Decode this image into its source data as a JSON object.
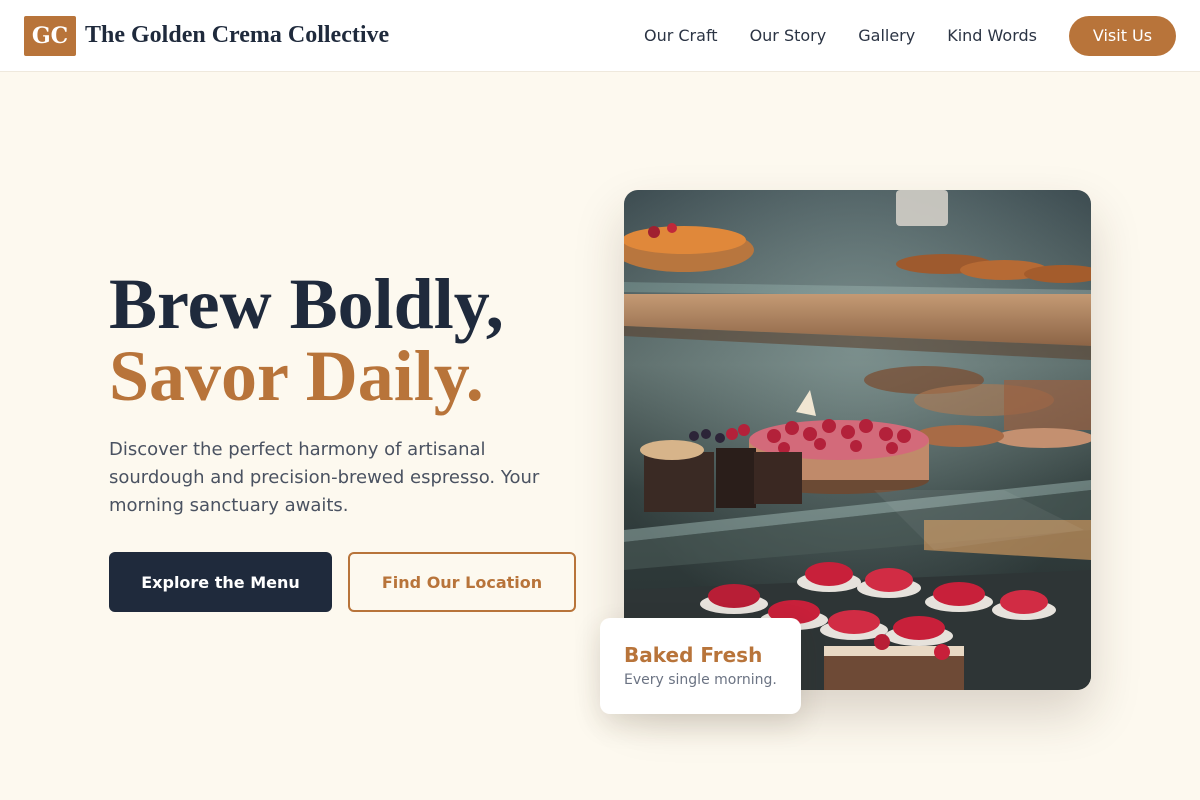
{
  "brand": {
    "logo_text": "GC",
    "name": "The Golden Crema Collective"
  },
  "nav": {
    "links": [
      "Our Craft",
      "Our Story",
      "Gallery",
      "Kind Words"
    ],
    "cta_label": "Visit Us"
  },
  "hero": {
    "headline_line1": "Brew Boldly,",
    "headline_line2": "Savor Daily.",
    "description": "Discover the perfect harmony of artisanal sourdough and precision-brewed espresso. Your morning sanctuary awaits.",
    "primary_button": "Explore the Menu",
    "secondary_button": "Find Our Location",
    "image_subject": "pastry display case with berry tarts",
    "badge": {
      "title": "Baked Fresh",
      "subtitle": "Every single morning."
    }
  },
  "colors": {
    "accent": "#b8743a",
    "dark": "#1f2a3c",
    "background": "#fdf9ef",
    "body_text": "#4a5261"
  }
}
